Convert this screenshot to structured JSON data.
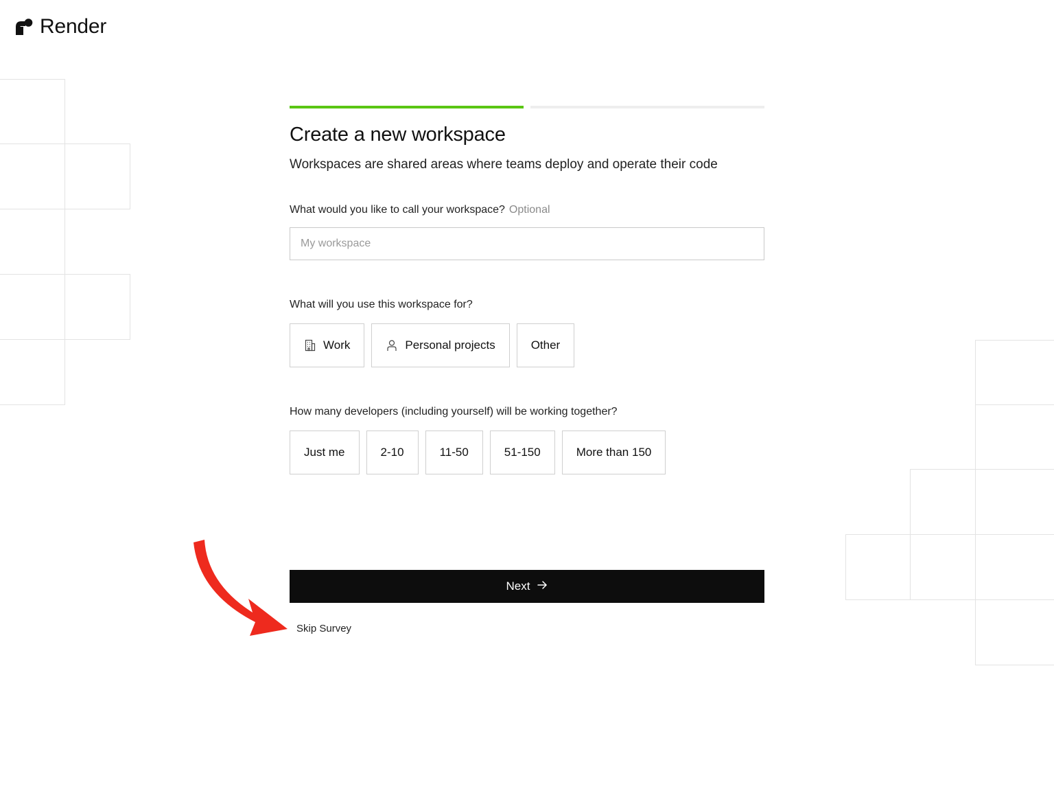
{
  "brand": {
    "name": "Render",
    "icon": "render-logo-icon"
  },
  "progress": {
    "current_step": 1,
    "total_steps": 2,
    "accent": "#5ac613"
  },
  "header": {
    "title": "Create a new workspace",
    "subtitle": "Workspaces are shared areas where teams deploy and operate their code"
  },
  "workspace_name": {
    "label": "What would you like to call your workspace?",
    "optional": "Optional",
    "placeholder": "My workspace",
    "value": ""
  },
  "usage": {
    "label": "What will you use this workspace for?",
    "options": [
      {
        "label": "Work",
        "icon": "building-icon"
      },
      {
        "label": "Personal projects",
        "icon": "person-icon"
      },
      {
        "label": "Other",
        "icon": ""
      }
    ]
  },
  "team_size": {
    "label": "How many developers (including yourself) will be working together?",
    "options": [
      "Just me",
      "2-10",
      "11-50",
      "51-150",
      "More than 150"
    ]
  },
  "actions": {
    "next_label": "Next",
    "next_icon": "arrow-right-icon",
    "skip_label": "Skip Survey"
  },
  "colors": {
    "primary_button": "#0d0d0d",
    "annotation_arrow": "#ee2a1e"
  }
}
